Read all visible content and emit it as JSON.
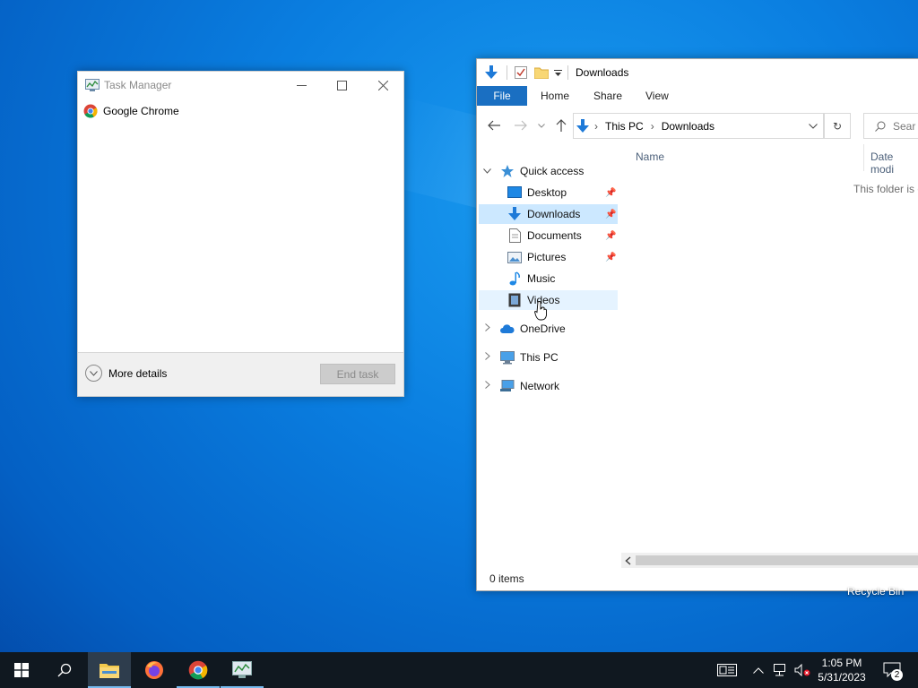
{
  "desktop": {
    "recycle_bin_label": "Recycle Bin"
  },
  "task_manager": {
    "title": "Task Manager",
    "apps": [
      {
        "name": "Google Chrome",
        "icon": "chrome-icon"
      }
    ],
    "more_details": "More details",
    "end_task": "End task"
  },
  "explorer": {
    "title": "Downloads",
    "ribbon_tabs": [
      "File",
      "Home",
      "Share",
      "View"
    ],
    "breadcrumb": [
      "This PC",
      "Downloads"
    ],
    "search_placeholder": "Sear",
    "nav": {
      "quick_access": "Quick access",
      "items": [
        {
          "label": "Desktop",
          "icon": "desktop-icon",
          "pinned": true
        },
        {
          "label": "Downloads",
          "icon": "downloads-icon",
          "pinned": true,
          "selected": true
        },
        {
          "label": "Documents",
          "icon": "documents-icon",
          "pinned": true
        },
        {
          "label": "Pictures",
          "icon": "pictures-icon",
          "pinned": true
        },
        {
          "label": "Music",
          "icon": "music-icon",
          "pinned": false
        },
        {
          "label": "Videos",
          "icon": "videos-icon",
          "pinned": false,
          "hovered": true
        }
      ],
      "roots": [
        "OneDrive",
        "This PC",
        "Network"
      ]
    },
    "columns": [
      "Name",
      "Date modi"
    ],
    "empty_message": "This folder is e",
    "status": "0 items"
  },
  "taskbar": {
    "apps": [
      "start-icon",
      "search-icon",
      "file-explorer-icon",
      "firefox-icon",
      "chrome-icon",
      "task-manager-icon"
    ],
    "time": "1:05 PM",
    "date": "5/31/2023",
    "notification_count": "2"
  },
  "colors": {
    "accent": "#1a6fc2",
    "selection": "#cce8ff",
    "taskbar": "#101820"
  }
}
